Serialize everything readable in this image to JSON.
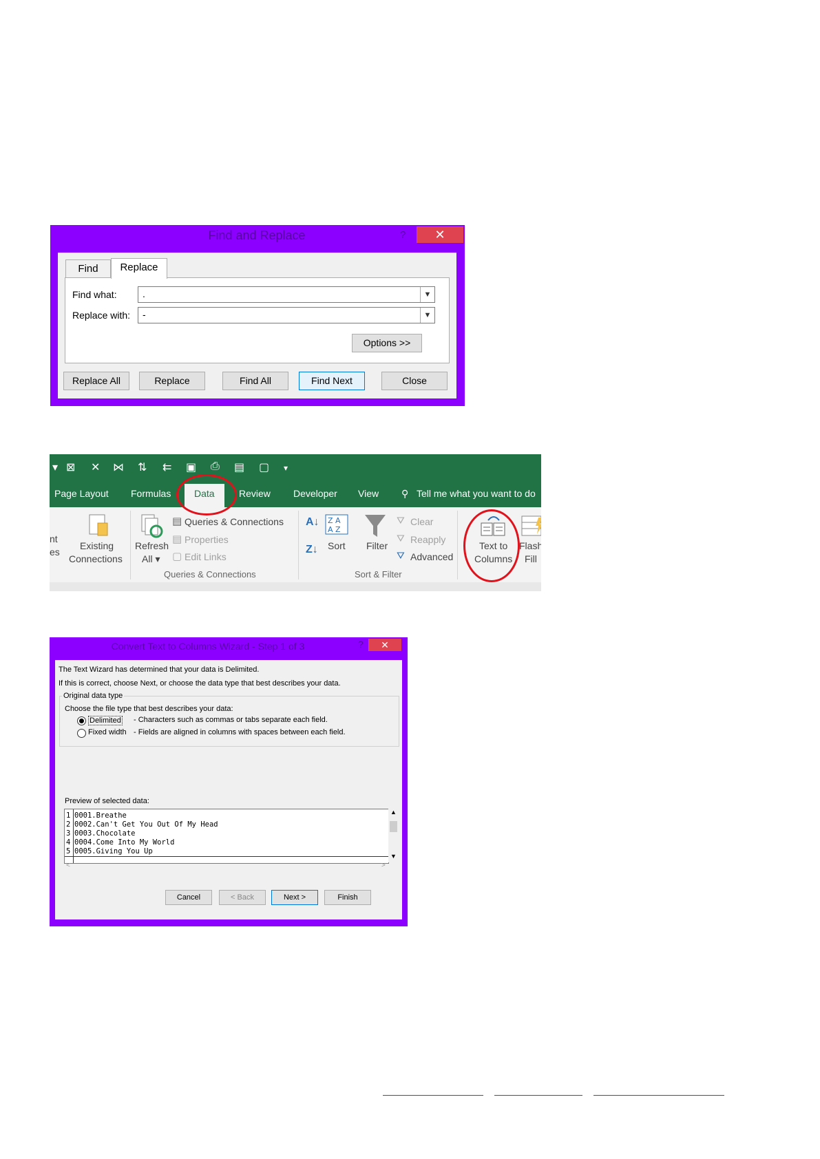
{
  "find_replace": {
    "title": "Find and Replace",
    "help": "?",
    "close_glyph": "✕",
    "tabs": [
      "Find",
      "Replace"
    ],
    "find_label": "Find what:",
    "find_value": ".",
    "replace_label": "Replace with:",
    "replace_value": "-",
    "options_button": "Options >>",
    "buttons": [
      "Replace All",
      "Replace",
      "Find All",
      "Find Next",
      "Close"
    ]
  },
  "ribbon": {
    "tabs": [
      "Page Layout",
      "Formulas",
      "Data",
      "Review",
      "Developer",
      "View"
    ],
    "tell_me": "Tell me what you want to do",
    "existing_connections": [
      "Existing",
      "Connections"
    ],
    "refresh_all": [
      "Refresh",
      "All ▾"
    ],
    "queries_connections": "Queries & Connections",
    "properties": "Properties",
    "edit_links": "Edit Links",
    "queries_group": "Queries & Connections",
    "sort": "Sort",
    "filter": "Filter",
    "clear": "Clear",
    "reapply": "Reapply",
    "advanced": "Advanced",
    "sort_filter_group": "Sort & Filter",
    "text_to_columns": [
      "Text to",
      "Columns"
    ],
    "flash_fill": [
      "Flash",
      "Fill"
    ],
    "partial_left": [
      "nt",
      "es"
    ]
  },
  "wizard": {
    "title": "Convert Text to Columns Wizard - Step 1 of 3",
    "help": "?",
    "close_glyph": "✕",
    "line1": "The Text Wizard has determined that your data is Delimited.",
    "line2": "If this is correct, choose Next, or choose the data type that best describes your data.",
    "group_label": "Original data type",
    "choose_label": "Choose the file type that best describes your data:",
    "opt1_label": "Delimited",
    "opt1_desc": "- Characters such as commas or tabs separate each field.",
    "opt2_label": "Fixed width",
    "opt2_desc": "- Fields are aligned in columns with spaces between each field.",
    "preview_label": "Preview of selected data:",
    "preview_rows": [
      {
        "n": "1",
        "text": "0001.Breathe"
      },
      {
        "n": "2",
        "text": "0002.Can't Get You Out Of My Head"
      },
      {
        "n": "3",
        "text": "0003.Chocolate"
      },
      {
        "n": "4",
        "text": "0004.Come Into My World"
      },
      {
        "n": "5",
        "text": "0005.Giving You Up"
      }
    ],
    "buttons": [
      "Cancel",
      "< Back",
      "Next >",
      "Finish"
    ]
  }
}
